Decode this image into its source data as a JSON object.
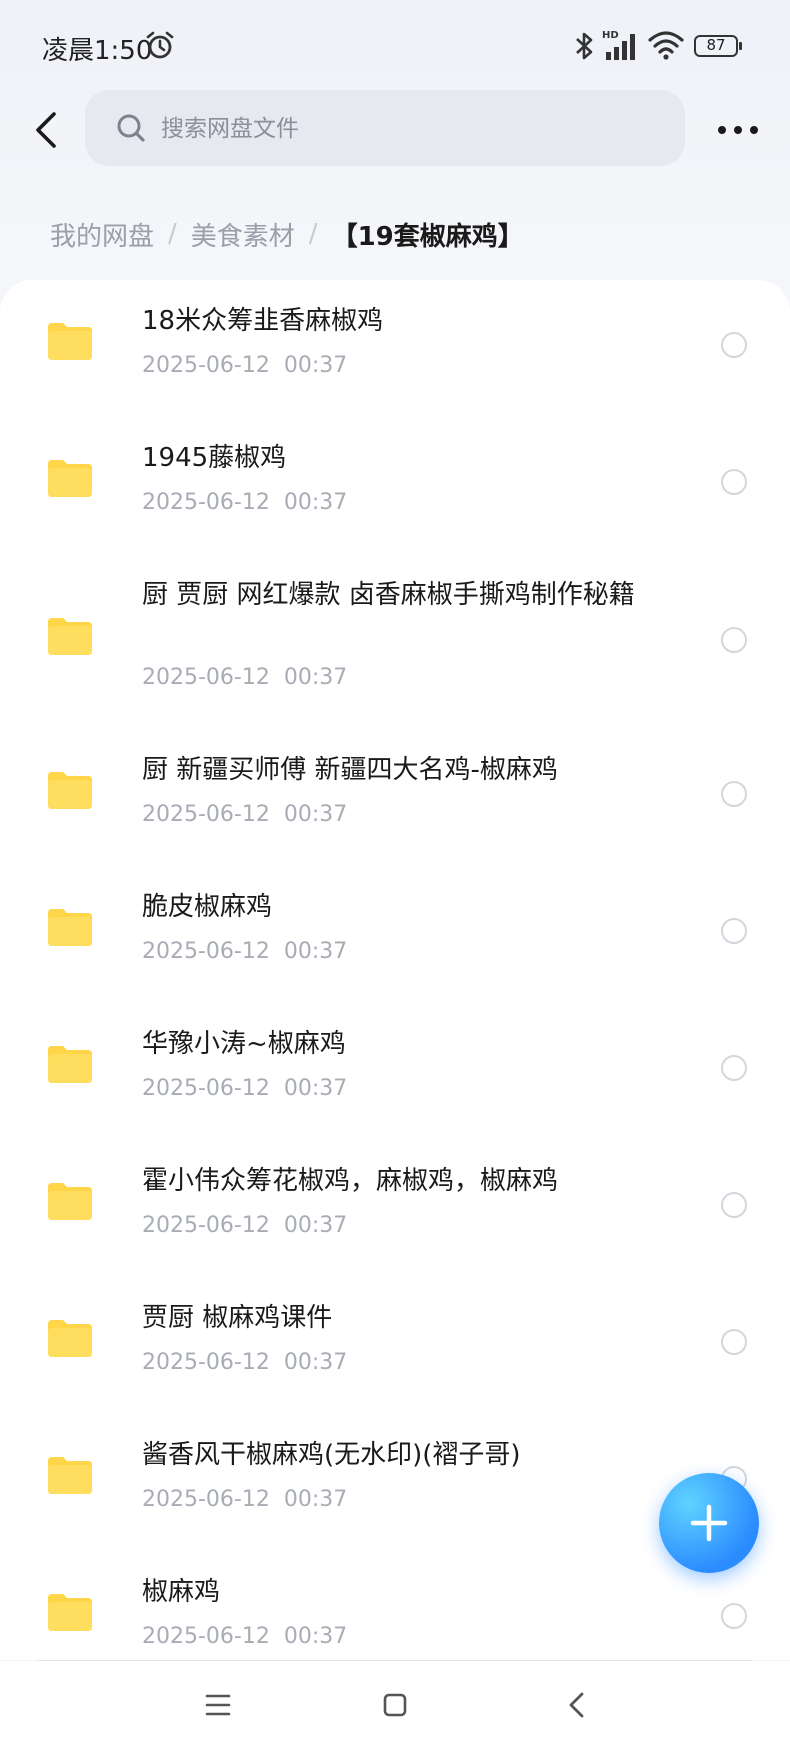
{
  "status_bar": {
    "time": "凌晨1:50",
    "battery": "87",
    "icons": [
      "alarm-icon",
      "bluetooth-icon",
      "hd-signal-icon",
      "wifi-icon",
      "battery-icon"
    ]
  },
  "header": {
    "search_placeholder": "搜索网盘文件"
  },
  "breadcrumb": {
    "items": [
      "我的网盘",
      "美食素材"
    ],
    "current": "【19套椒麻鸡】"
  },
  "files": [
    {
      "name": "18米众筹韭香麻椒鸡",
      "date": "2025-06-12  00:37"
    },
    {
      "name": "1945藤椒鸡",
      "date": "2025-06-12  00:37"
    },
    {
      "name": "厨 贾厨 网红爆款 卤香麻椒手撕鸡制作秘籍",
      "date": "2025-06-12  00:37"
    },
    {
      "name": "厨 新疆买师傅 新疆四大名鸡-椒麻鸡",
      "date": "2025-06-12  00:37"
    },
    {
      "name": "脆皮椒麻鸡",
      "date": "2025-06-12  00:37"
    },
    {
      "name": "华豫小涛~椒麻鸡",
      "date": "2025-06-12  00:37"
    },
    {
      "name": "霍小伟众筹花椒鸡，麻椒鸡，椒麻鸡",
      "date": "2025-06-12  00:37"
    },
    {
      "name": "贾厨 椒麻鸡课件",
      "date": "2025-06-12  00:37"
    },
    {
      "name": "酱香风干椒麻鸡(无水印)(褶子哥)",
      "date": "2025-06-12  00:37"
    },
    {
      "name": "椒麻鸡",
      "date": "2025-06-12  00:37"
    }
  ],
  "colors": {
    "folder": "#FFD54A",
    "accent": "#2B8CFF",
    "date_text": "#A8ACB4"
  }
}
